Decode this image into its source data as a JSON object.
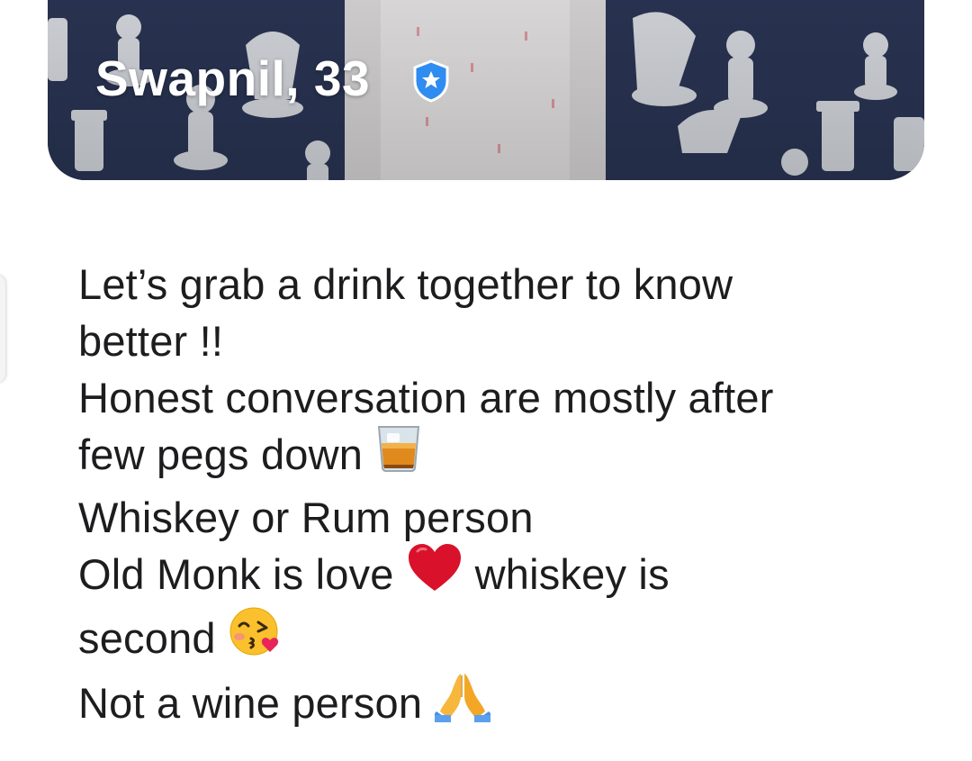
{
  "profile": {
    "name_age": "Swapnil, 33",
    "verified": true,
    "badge_color": "#2f8cf0"
  },
  "photo": {
    "background_color": "#2b3656",
    "pattern_color": "#e9ecef",
    "shirt_color": "#e8e6e6"
  },
  "bio": {
    "lines": [
      {
        "text": "Let’s grab a drink together to know",
        "emoji": ""
      },
      {
        "text": "better !!",
        "emoji": ""
      },
      {
        "text": "Honest conversation are mostly after",
        "emoji": ""
      },
      {
        "text": "few pegs down",
        "emoji": "whiskey-glass-icon"
      },
      {
        "text": "Whiskey or Rum person",
        "emoji": ""
      },
      {
        "text": "Old Monk is love",
        "emoji": "red-heart-icon",
        "after": "whiskey is"
      },
      {
        "text": "second",
        "emoji": "kissing-face-icon"
      },
      {
        "text": "Not a wine person",
        "emoji": "folded-hands-icon"
      }
    ],
    "text_color": "#1d1d1f"
  }
}
